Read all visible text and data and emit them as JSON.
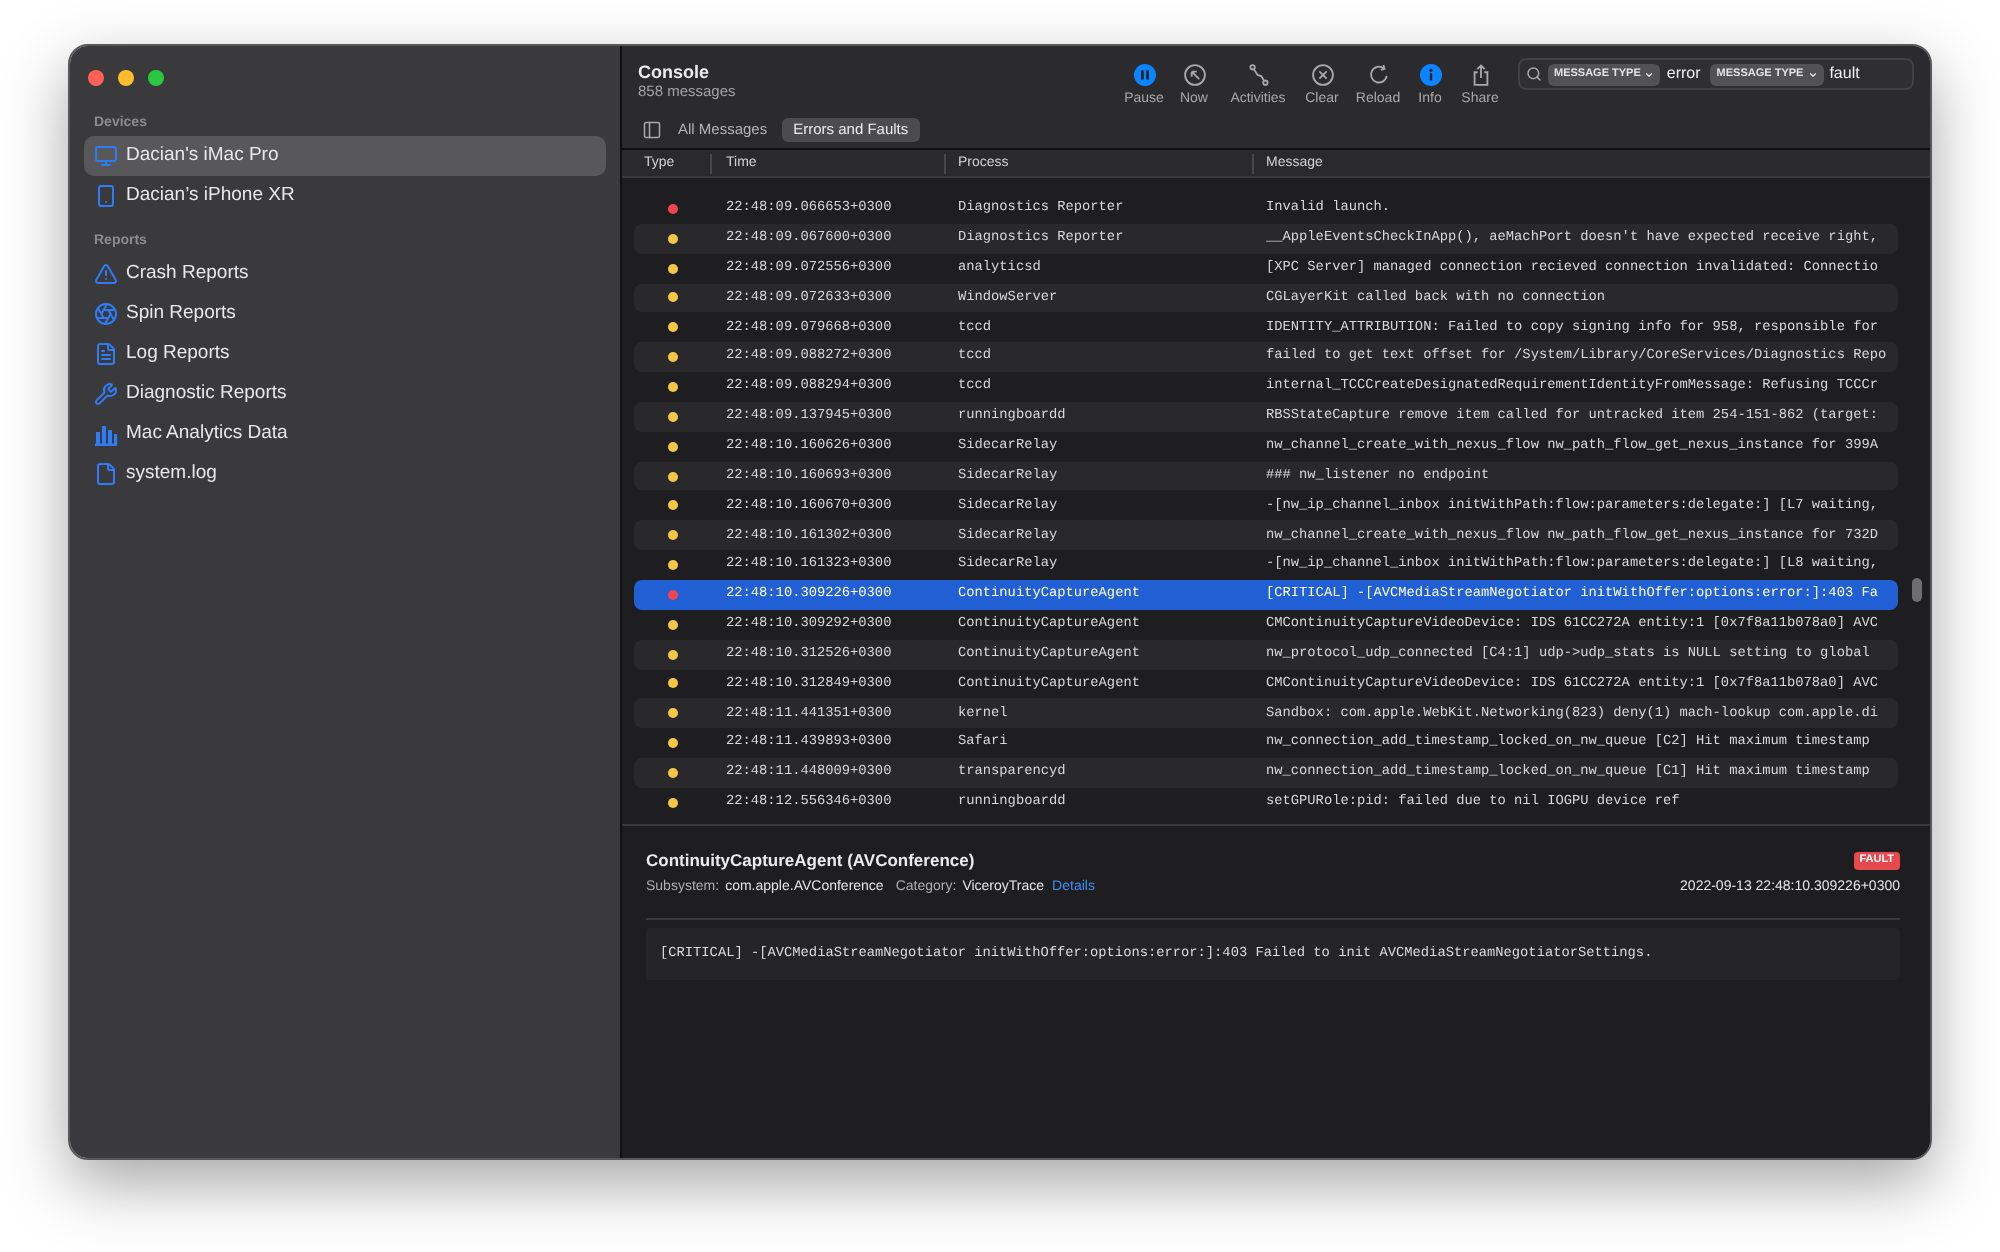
{
  "sidebar": {
    "sections": [
      {
        "title": "Devices",
        "items": [
          {
            "label": "Dacian's iMac Pro",
            "selected": true
          },
          {
            "label": "Dacian’s iPhone XR",
            "selected": false
          }
        ]
      },
      {
        "title": "Reports",
        "items": [
          {
            "label": "Crash Reports",
            "selected": false
          },
          {
            "label": "Spin Reports",
            "selected": false
          },
          {
            "label": "Log Reports",
            "selected": false
          },
          {
            "label": "Diagnostic Reports",
            "selected": false
          },
          {
            "label": "Mac Analytics Data",
            "selected": false
          },
          {
            "label": "system.log",
            "selected": false
          }
        ]
      }
    ]
  },
  "toolbar": {
    "title": "Console",
    "subtitle": "858 messages",
    "buttons": [
      {
        "label": "Pause",
        "on": true
      },
      {
        "label": "Now",
        "on": false
      },
      {
        "label": "Activities",
        "on": false
      },
      {
        "label": "Clear",
        "on": false
      },
      {
        "label": "Reload",
        "on": false
      },
      {
        "label": "Info",
        "on": true
      },
      {
        "label": "Share",
        "on": false
      }
    ],
    "search": {
      "tokens": [
        {
          "field": "MESSAGE TYPE",
          "value": "error"
        },
        {
          "field": "MESSAGE TYPE",
          "value": "fault"
        }
      ]
    }
  },
  "filter_tabs": [
    {
      "label": "All Messages",
      "selected": false
    },
    {
      "label": "Errors and Faults",
      "selected": true
    }
  ],
  "table": {
    "columns": [
      "Type",
      "Time",
      "Process",
      "Message"
    ],
    "rows": [
      {
        "color": "#f2444f",
        "time": "22:48:09.066653+0300",
        "process": "Diagnostics Reporter",
        "message": "Invalid launch.",
        "selected": false
      },
      {
        "color": "#f6c744",
        "time": "22:48:09.067600+0300",
        "process": "Diagnostics Reporter",
        "message": "__AppleEventsCheckInApp(), aeMachPort doesn't have expected receive right,",
        "selected": false
      },
      {
        "color": "#f6c744",
        "time": "22:48:09.072556+0300",
        "process": "analyticsd",
        "message": "[XPC Server] managed connection recieved connection invalidated: Connectio",
        "selected": false
      },
      {
        "color": "#f6c744",
        "time": "22:48:09.072633+0300",
        "process": "WindowServer",
        "message": "CGLayerKit called back with no connection",
        "selected": false
      },
      {
        "color": "#f6c744",
        "time": "22:48:09.079668+0300",
        "process": "tccd",
        "message": "IDENTITY_ATTRIBUTION: Failed to copy signing info for 958, responsible for",
        "selected": false
      },
      {
        "color": "#f6c744",
        "time": "22:48:09.088272+0300",
        "process": "tccd",
        "message": "failed to get text offset for /System/Library/CoreServices/Diagnostics Repo",
        "selected": false
      },
      {
        "color": "#f6c744",
        "time": "22:48:09.088294+0300",
        "process": "tccd",
        "message": "internal_TCCCreateDesignatedRequirementIdentityFromMessage: Refusing TCCCr",
        "selected": false
      },
      {
        "color": "#f6c744",
        "time": "22:48:09.137945+0300",
        "process": "runningboardd",
        "message": "RBSStateCapture remove item called for untracked item 254-151-862 (target:",
        "selected": false
      },
      {
        "color": "#f6c744",
        "time": "22:48:10.160626+0300",
        "process": "SidecarRelay",
        "message": "nw_channel_create_with_nexus_flow nw_path_flow_get_nexus_instance for 399A",
        "selected": false
      },
      {
        "color": "#f6c744",
        "time": "22:48:10.160693+0300",
        "process": "SidecarRelay",
        "message": "### nw_listener no endpoint",
        "selected": false
      },
      {
        "color": "#f6c744",
        "time": "22:48:10.160670+0300",
        "process": "SidecarRelay",
        "message": "-[nw_ip_channel_inbox initWithPath:flow:parameters:delegate:] [L7 waiting,",
        "selected": false
      },
      {
        "color": "#f6c744",
        "time": "22:48:10.161302+0300",
        "process": "SidecarRelay",
        "message": "nw_channel_create_with_nexus_flow nw_path_flow_get_nexus_instance for 732D",
        "selected": false
      },
      {
        "color": "#f6c744",
        "time": "22:48:10.161323+0300",
        "process": "SidecarRelay",
        "message": "-[nw_ip_channel_inbox initWithPath:flow:parameters:delegate:] [L8 waiting,",
        "selected": false
      },
      {
        "color": "#f2444f",
        "time": "22:48:10.309226+0300",
        "process": "ContinuityCaptureAgent",
        "message": "[CRITICAL] -[AVCMediaStreamNegotiator initWithOffer:options:error:]:403 Fa",
        "selected": true
      },
      {
        "color": "#f6c744",
        "time": "22:48:10.309292+0300",
        "process": "ContinuityCaptureAgent",
        "message": "CMContinuityCaptureVideoDevice: IDS 61CC272A entity:1 [0x7f8a11b078a0] AVC",
        "selected": false
      },
      {
        "color": "#f6c744",
        "time": "22:48:10.312526+0300",
        "process": "ContinuityCaptureAgent",
        "message": "nw_protocol_udp_connected [C4:1] udp->udp_stats is NULL setting to global",
        "selected": false
      },
      {
        "color": "#f6c744",
        "time": "22:48:10.312849+0300",
        "process": "ContinuityCaptureAgent",
        "message": "CMContinuityCaptureVideoDevice: IDS 61CC272A entity:1 [0x7f8a11b078a0] AVC",
        "selected": false
      },
      {
        "color": "#f6c744",
        "time": "22:48:11.441351+0300",
        "process": "kernel",
        "message": "Sandbox: com.apple.WebKit.Networking(823) deny(1) mach-lookup com.apple.di",
        "selected": false
      },
      {
        "color": "#f6c744",
        "time": "22:48:11.439893+0300",
        "process": "Safari",
        "message": "nw_connection_add_timestamp_locked_on_nw_queue [C2] Hit maximum timestamp",
        "selected": false
      },
      {
        "color": "#f6c744",
        "time": "22:48:11.448009+0300",
        "process": "transparencyd",
        "message": "nw_connection_add_timestamp_locked_on_nw_queue [C1] Hit maximum timestamp",
        "selected": false
      },
      {
        "color": "#f6c744",
        "time": "22:48:12.556346+0300",
        "process": "runningboardd",
        "message": "setGPURole:pid: failed due to nil IOGPU device ref",
        "selected": false
      }
    ]
  },
  "detail": {
    "title": "ContinuityCaptureAgent (AVConference)",
    "badge": "FAULT",
    "fields": [
      {
        "label": "Subsystem:",
        "value": "com.apple.AVConference"
      },
      {
        "label": "Category:",
        "value": "ViceroyTrace"
      }
    ],
    "link": "Details",
    "timestamp": "2022-09-13 22:48:10.309226+0300",
    "message": "[CRITICAL] -[AVCMediaStreamNegotiator initWithOffer:options:error:]:403 Failed to init AVCMediaStreamNegotiatorSettings."
  }
}
